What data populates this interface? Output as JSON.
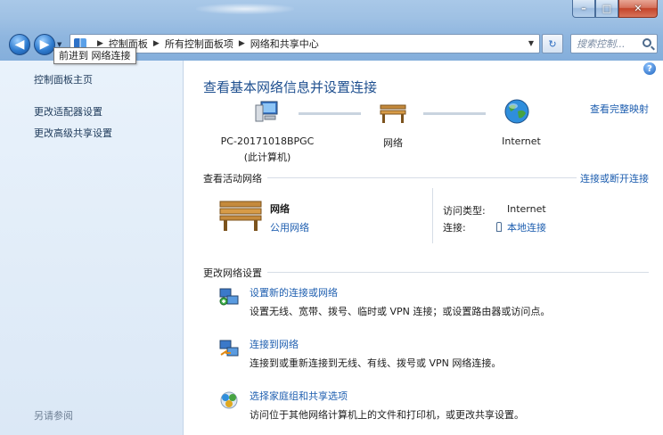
{
  "window": {
    "title_blur": "",
    "controls": {
      "minimize": "–",
      "maximize": "□",
      "close": "✕"
    }
  },
  "nav": {
    "back_glyph": "◀",
    "forward_glyph": "▶",
    "recent_glyph": "▼"
  },
  "address": {
    "crumbs": [
      "控制面板",
      "所有控制面板项",
      "网络和共享中心"
    ],
    "separator": "▶",
    "dropdown_glyph": "▼",
    "refresh_glyph": "↻"
  },
  "search": {
    "placeholder": "搜索控制..."
  },
  "tooltip": {
    "text": "前进到 网络连接"
  },
  "left_pane": {
    "items": [
      "控制面板主页",
      "更改适配器设置",
      "更改高级共享设置"
    ],
    "see_also": "另请参阅"
  },
  "main": {
    "help_glyph": "?",
    "title": "查看基本网络信息并设置连接",
    "full_map_link": "查看完整映射",
    "map": {
      "computer": {
        "name": "PC-20171018BPGC",
        "sub": "(此计算机)",
        "icon": "computer-icon"
      },
      "network": {
        "name": "网络",
        "icon": "bench-network-icon"
      },
      "internet": {
        "name": "Internet",
        "icon": "globe-icon"
      }
    },
    "active": {
      "section_title": "查看活动网络",
      "connect_link": "连接或断开连接",
      "network_name": "网络",
      "network_type": "公用网络",
      "access_type_label": "访问类型:",
      "access_type_value": "Internet",
      "connections_label": "连接:",
      "connections_value": "本地连接"
    },
    "change": {
      "section_title": "更改网络设置",
      "tasks": [
        {
          "link": "设置新的连接或网络",
          "desc": "设置无线、宽带、拨号、临时或 VPN 连接；或设置路由器或访问点。",
          "icon": "new-connection-icon"
        },
        {
          "link": "连接到网络",
          "desc": "连接到或重新连接到无线、有线、拨号或 VPN 网络连接。",
          "icon": "connect-network-icon"
        },
        {
          "link": "选择家庭组和共享选项",
          "desc": "访问位于其他网络计算机上的文件和打印机，或更改共享设置。",
          "icon": "homegroup-icon"
        }
      ]
    }
  },
  "colors": {
    "link": "#1f5fb0",
    "title": "#1e4f8f",
    "chrome": "#9fc1e4",
    "left_pane": "#e3eef9"
  }
}
